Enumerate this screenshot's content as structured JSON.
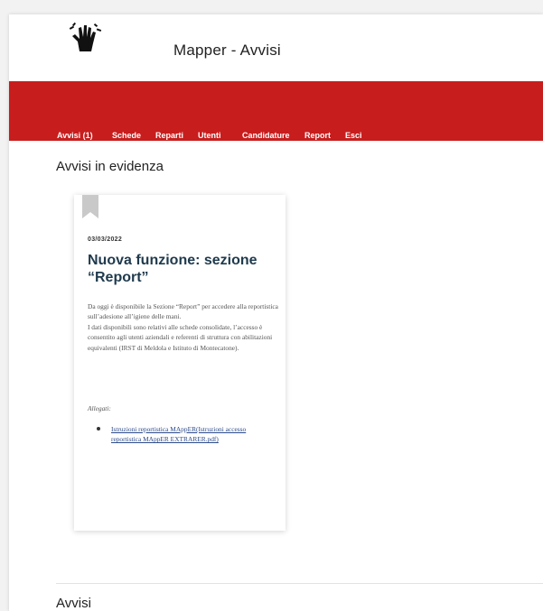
{
  "app": {
    "title": "Mapper - Avvisi",
    "logo_icon": "hand-sign-logo-icon"
  },
  "nav": {
    "items": [
      {
        "label": "Avvisi (1)"
      },
      {
        "label": "Schede"
      },
      {
        "label": "Reparti"
      },
      {
        "label": "Utenti"
      },
      {
        "label": "Candidature"
      },
      {
        "label": "Report"
      },
      {
        "label": "Esci"
      }
    ]
  },
  "highlighted": {
    "title": "Avvisi in evidenza",
    "card": {
      "date": "03/03/2022",
      "title": "Nuova funzione: sezione “Report”",
      "paragraphs": [
        "Da oggi è disponibile la Sezione “Report” per accedere alla reportistica sull’adesione all’igiene delle mani.",
        "I dati disponibili sono relativi alle schede consolidate, l’accesso è consentito agli utenti aziendali e referenti di struttura con abilitazioni equivalenti (IRST di Meldola e Istituto di Montecatone)."
      ],
      "attachments_label": "Allegati:",
      "attachments": [
        {
          "label": "Istruzioni reportistica MAppER(Istruzioni accesso reportistica MAppER EXTRARER.pdf)"
        }
      ]
    }
  },
  "avvisi": {
    "title": "Avvisi"
  },
  "colors": {
    "nav_bg": "#c81d1d",
    "title_dark_blue": "#1f3a4d",
    "link": "#2b4a8a"
  }
}
